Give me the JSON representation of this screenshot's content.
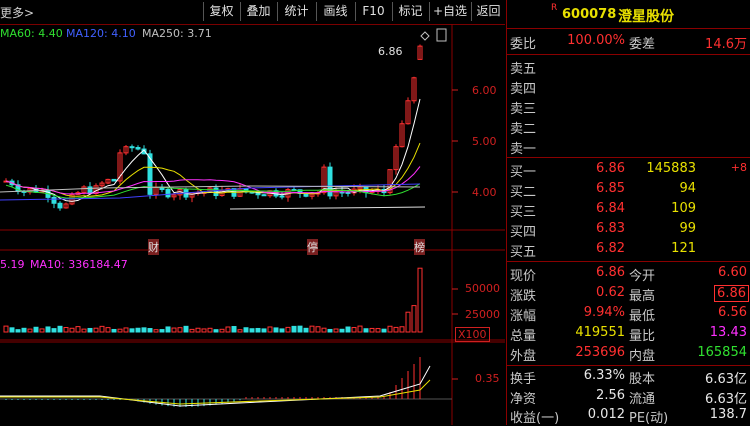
{
  "toolbar": {
    "more": "更多>",
    "buttons": [
      "复权",
      "叠加",
      "统计",
      "画线",
      "F10",
      "标记",
      "+自选",
      "返回"
    ]
  },
  "ma_main": {
    "ma60": "MA60: 4.40",
    "ma120": "MA120: 4.10",
    "ma250": "MA250: 3.71"
  },
  "vol_line": {
    "prefix": "5.19",
    "ma10": "MA10: 336184.47"
  },
  "price_axis": [
    "6.00",
    "5.00",
    "4.00"
  ],
  "high_mark": "6.86",
  "vol_axis": [
    "50000",
    "25000"
  ],
  "vol_unit": "X100",
  "macd_axis": "0.35",
  "markers": {
    "cai": "财",
    "ting": "停",
    "rong": "榜"
  },
  "stock": {
    "badge": "R",
    "code": "600078",
    "name": "澄星股份"
  },
  "weibi": {
    "label": "委比",
    "value": "100.00%",
    "label2": "委差",
    "value2": "14.6万"
  },
  "sell": [
    {
      "label": "卖五"
    },
    {
      "label": "卖四"
    },
    {
      "label": "卖三"
    },
    {
      "label": "卖二"
    },
    {
      "label": "卖一"
    }
  ],
  "buy": [
    {
      "label": "买一",
      "price": "6.86",
      "vol": "145883",
      "chg": "+8"
    },
    {
      "label": "买二",
      "price": "6.85",
      "vol": "94"
    },
    {
      "label": "买三",
      "price": "6.84",
      "vol": "109"
    },
    {
      "label": "买四",
      "price": "6.83",
      "vol": "99"
    },
    {
      "label": "买五",
      "price": "6.82",
      "vol": "121"
    }
  ],
  "quote": {
    "r1": {
      "l1": "现价",
      "v1": "6.86",
      "l2": "今开",
      "v2": "6.60"
    },
    "r2": {
      "l1": "涨跌",
      "v1": "0.62",
      "l2": "最高",
      "v2": "6.86"
    },
    "r3": {
      "l1": "涨幅",
      "v1": "9.94%",
      "l2": "最低",
      "v2": "6.56"
    },
    "r4": {
      "l1": "总量",
      "v1": "419551",
      "l2": "量比",
      "v2": "13.43"
    },
    "r5": {
      "l1": "外盘",
      "v1": "253696",
      "l2": "内盘",
      "v2": "165854"
    },
    "r6": {
      "l1": "换手",
      "v1": "6.33%",
      "l2": "股本",
      "v2": "6.63亿"
    },
    "r7": {
      "l1": "净资",
      "v1": "2.56",
      "l2": "流通",
      "v2": "6.63亿"
    },
    "r8": {
      "l1": "收益(一)",
      "v1": "0.012",
      "l2": "PE(动)",
      "v2": "138.7"
    }
  },
  "colors": {
    "up": "#ff3030",
    "down": "#30e0e0",
    "ma5": "#ffffff",
    "ma10": "#e8e000",
    "ma20": "#ff30ff",
    "ma60": "#30e030",
    "ma120": "#4040ff",
    "ma250": "#c0c0c0"
  }
}
